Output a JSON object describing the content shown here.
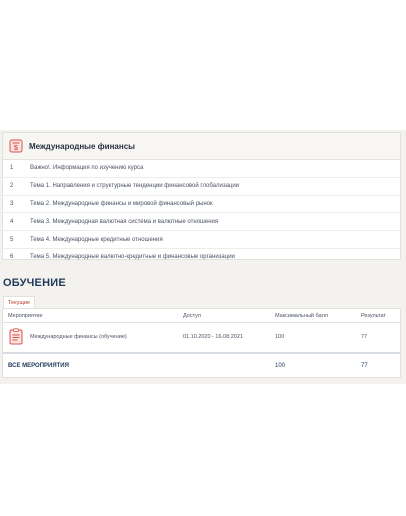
{
  "course": {
    "title": "Международные финансы",
    "topics": [
      {
        "num": "1",
        "label": "Важно!. Информация по изучению курса"
      },
      {
        "num": "2",
        "label": "Тема 1. Направления и структурные тенденции финансовой глобализации"
      },
      {
        "num": "3",
        "label": "Тема 2. Международные финансы и мировой финансовый рынок"
      },
      {
        "num": "4",
        "label": "Тема 3. Международная валютная система и валютные отношения"
      },
      {
        "num": "5",
        "label": "Тема 4. Международные кредитные отношения"
      },
      {
        "num": "6",
        "label": "Тема 5. Международные валютно-кредитные и финансовые организации"
      }
    ]
  },
  "training": {
    "section_title": "ОБУЧЕНИЕ",
    "tab_current": "Текущие",
    "columns": {
      "event": "Мероприятие",
      "access": "Доступ",
      "max_score": "Максимальный балл",
      "result": "Результат"
    },
    "rows": [
      {
        "event": "Международные финансы (обучение)",
        "access": "01.10.2020 - 16.08.2021",
        "max_score": "100",
        "result": "77"
      }
    ],
    "total": {
      "label": "ВСЕ МЕРОПРИЯТИЯ",
      "max_score": "100",
      "result": "77"
    }
  },
  "colors": {
    "accent": "#c0392b",
    "title": "#1f3a5a",
    "background": "#f3f2ef"
  },
  "icons": {
    "course": "dollar-document-icon",
    "event": "clipboard-icon"
  }
}
